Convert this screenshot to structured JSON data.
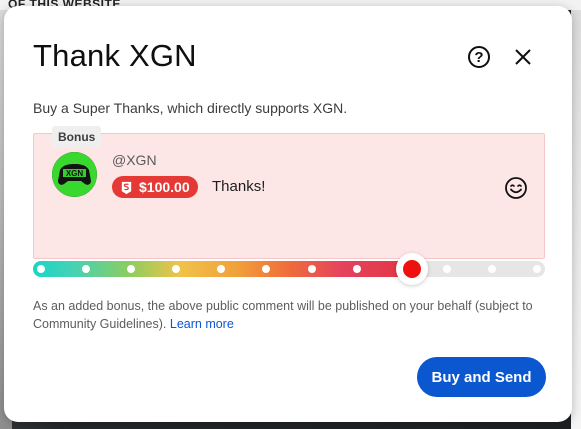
{
  "background": {
    "top_text": "OF THIS WEBSITE"
  },
  "dialog": {
    "title": "Thank XGN",
    "subtitle": "Buy a Super Thanks, which directly supports XGN.",
    "help_icon": "help-circle-icon",
    "close_icon": "close-icon"
  },
  "comment": {
    "bonus_label": "Bonus",
    "avatar_text": "XGN",
    "handle": "@XGN",
    "amount": "$100.00",
    "text": "Thanks!",
    "emoji_icon": "smile-icon"
  },
  "slider": {
    "selected_fraction": 0.74,
    "tick_count": 12
  },
  "note": {
    "text": "As an added bonus, the above public comment will be published on your behalf (subject to Community Guidelines).",
    "link_text": "Learn more"
  },
  "actions": {
    "buy_label": "Buy and Send"
  },
  "colors": {
    "primary": "#0b57d0",
    "amount_badge": "#e53935",
    "card_bg": "#fde6e6",
    "thumb_red": "#ef1010",
    "avatar_green": "#38d82f"
  }
}
